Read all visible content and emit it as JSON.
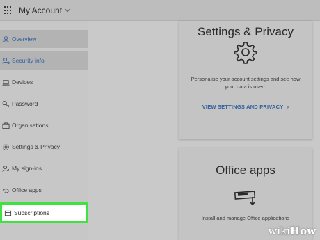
{
  "header": {
    "app_title": "My Account"
  },
  "sidebar": {
    "items": [
      {
        "label": "Overview",
        "icon": "person-icon"
      },
      {
        "label": "Security info",
        "icon": "security-person-icon"
      },
      {
        "label": "Devices",
        "icon": "laptop-icon"
      },
      {
        "label": "Password",
        "icon": "key-icon"
      },
      {
        "label": "Organisations",
        "icon": "briefcase-icon"
      },
      {
        "label": "Settings & Privacy",
        "icon": "gear-icon"
      },
      {
        "label": "My sign-ins",
        "icon": "sign-in-person-icon"
      },
      {
        "label": "Office apps",
        "icon": "office-apps-icon"
      },
      {
        "label": "Subscriptions",
        "icon": "subscription-card-icon"
      }
    ]
  },
  "cards": {
    "settings": {
      "title": "Settings & Privacy",
      "description": "Personalise your account settings and see how your data is used.",
      "link": "VIEW SETTINGS AND PRIVACY",
      "link_chevron": "›"
    },
    "office": {
      "title": "Office apps",
      "description": "Install and manage Office applications"
    }
  },
  "watermark": {
    "wiki": "wiki",
    "how": "How"
  },
  "colors": {
    "accent": "#2f5f9c",
    "highlight": "#3fe23f",
    "background": "#c9c9c9"
  }
}
